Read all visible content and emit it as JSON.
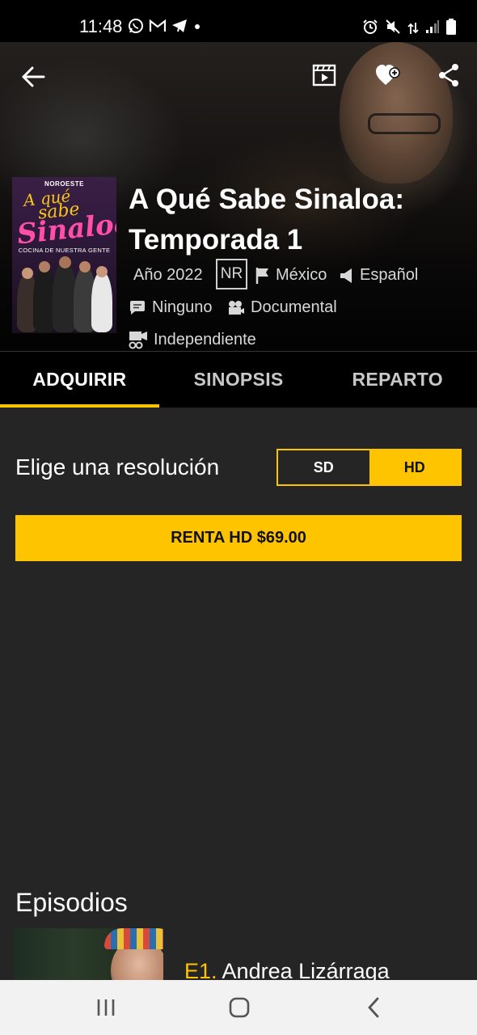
{
  "status_bar": {
    "time": "11:48",
    "left_icons": [
      "whatsapp-icon",
      "gmail-icon",
      "telegram-icon",
      "dot-icon"
    ],
    "right_icons": [
      "alarm-icon",
      "mute-icon",
      "data-arrows-icon",
      "signal-icon",
      "battery-icon"
    ]
  },
  "header": {
    "icons": [
      "back-arrow-icon",
      "trailer-icon",
      "favorite-add-icon",
      "share-icon"
    ]
  },
  "poster": {
    "brand": "NOROESTE",
    "line1": "A qué",
    "line2": "sabe",
    "line3": "Sinaloa",
    "subtitle": "COCINA DE NUESTRA GENTE"
  },
  "title": {
    "line1": "A Qué Sabe Sinaloa:",
    "line2": "Temporada 1"
  },
  "meta": {
    "year": "Año 2022",
    "rating": "NR",
    "country": "México",
    "language": "Español",
    "subtitles": "Ninguno",
    "genre": "Documental",
    "studio": "Independiente"
  },
  "tabs": [
    {
      "label": "ADQUIRIR",
      "active": true
    },
    {
      "label": "SINOPSIS",
      "active": false
    },
    {
      "label": "REPARTO",
      "active": false
    }
  ],
  "resolution": {
    "label": "Elige una resolución",
    "options": [
      "SD",
      "HD"
    ],
    "selected": "HD"
  },
  "rent_button": "RENTA HD $69.00",
  "episodes": {
    "heading": "Episodios",
    "items": [
      {
        "number": "E1.",
        "title": "Andrea Lizárraga"
      }
    ]
  },
  "colors": {
    "accent": "#ffc400",
    "background": "#252525",
    "tab_bar": "#000000"
  }
}
